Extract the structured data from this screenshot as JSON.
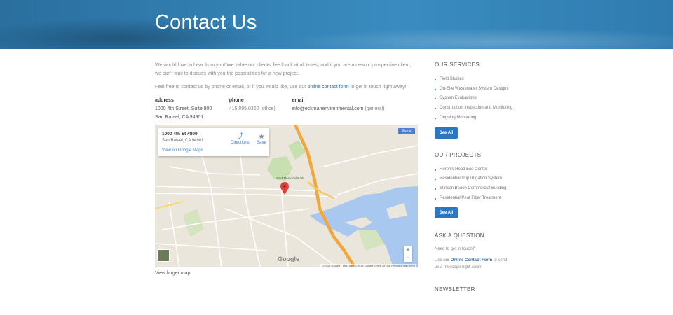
{
  "hero": {
    "title": "Contact Us"
  },
  "intro": {
    "p1": "We would love to hear from you!  We value our clients' feedback at all times, and if you are a new or prospective client, we can't wait to discuss with you the possibilities for a new project.",
    "p2_before": "Feel free to contact us by phone or email, or if you would like, use our ",
    "p2_link": "online contact form",
    "p2_after": " to get in touch right away!"
  },
  "contact": {
    "address_label": "address",
    "address_line1": "1000 4th Street, Suite 800",
    "address_line2": "San Rafael, CA 94901",
    "phone_label": "phone",
    "phone_value": "415.895.0362 (office)",
    "email_label": "email",
    "email_value": "info@eckmanenvironmental.com",
    "email_note": " (general)"
  },
  "map": {
    "card_address": "1000 4th St #800",
    "card_city": "San Rafael, CA 94901",
    "view_on_google": "View on Google Maps",
    "directions": "Directions",
    "save": "Save",
    "signin": "Sign in",
    "park_label": "Boyd Memorial Park",
    "google_logo": "Google",
    "attribution": "©2015 Google · Map data ©2015 Google     Terms of Use     Report a map error",
    "view_larger": "View larger map",
    "zoom_in": "+",
    "zoom_out": "−"
  },
  "sidebar": {
    "services_title": "OUR SERVICES",
    "services": [
      "Field Studies",
      "On-Site Wastewater System Designs",
      "System Evaluations",
      "Construction Inspection and Monitoring",
      "Ongoing Monitoring"
    ],
    "services_button": "See All",
    "projects_title": "OUR PROJECTS",
    "projects": [
      "Heron's Head Eco Center",
      "Residential Drip Irrigation System",
      "Stinson Beach Commercial Building",
      "Residential Peat Fiber Treatment"
    ],
    "projects_button": "See All",
    "ask_title": "ASK A QUESTION",
    "ask_line1": "Need to get in touch?",
    "ask_before": "Use our ",
    "ask_link": "Online Contact Form",
    "ask_after": " to send us a message right away!",
    "newsletter_title": "NEWSLETTER"
  }
}
